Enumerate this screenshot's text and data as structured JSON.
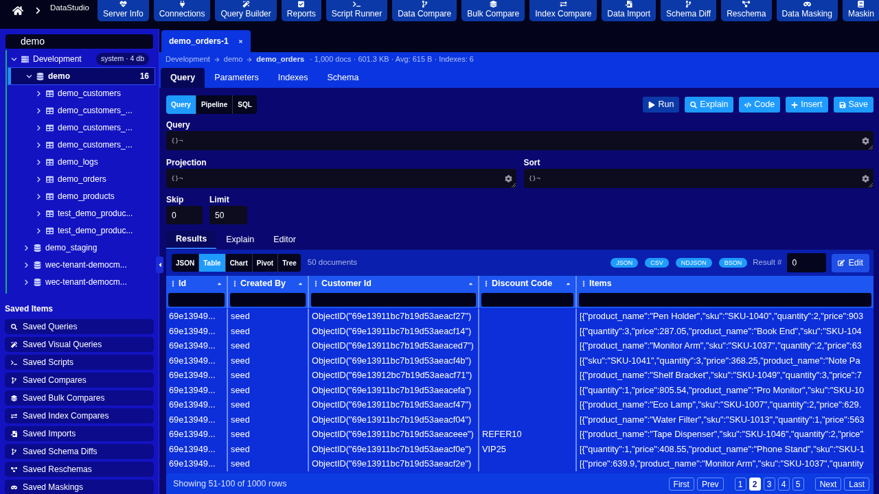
{
  "top_bar": {
    "app_name": "DataStudio",
    "nav": [
      {
        "label": "Server Info"
      },
      {
        "label": "Connections"
      },
      {
        "label": "Query Builder"
      },
      {
        "label": "Reports"
      },
      {
        "label": "Script Runner"
      },
      {
        "label": "Data Compare"
      },
      {
        "label": "Bulk Compare"
      },
      {
        "label": "Index Compare"
      },
      {
        "label": "Data Import"
      },
      {
        "label": "Schema Diff"
      },
      {
        "label": "Reschema"
      },
      {
        "label": "Data Masking"
      },
      {
        "label": "Maskin"
      }
    ]
  },
  "sidebar": {
    "search": {
      "value": "demo"
    },
    "tree": [
      {
        "label": "Development",
        "kind": "connection",
        "badge": "system · 4 db",
        "expanded": true,
        "selected": false,
        "children": [
          {
            "label": "demo",
            "kind": "database",
            "count": "16",
            "expanded": true,
            "selected": true,
            "children": [
              {
                "label": "demo_customers",
                "kind": "collection",
                "expanded": false,
                "selected": false
              },
              {
                "label": "demo_customers_...",
                "kind": "collection",
                "expanded": false,
                "selected": false
              },
              {
                "label": "demo_customers_...",
                "kind": "collection",
                "expanded": false,
                "selected": false
              },
              {
                "label": "demo_customers_...",
                "kind": "collection",
                "expanded": false,
                "selected": false
              },
              {
                "label": "demo_logs",
                "kind": "collection",
                "expanded": false,
                "selected": false
              },
              {
                "label": "demo_orders",
                "kind": "collection",
                "expanded": false,
                "selected": false
              },
              {
                "label": "demo_products",
                "kind": "collection",
                "expanded": false,
                "selected": false
              },
              {
                "label": "test_demo_produc...",
                "kind": "collection",
                "expanded": false,
                "selected": false
              },
              {
                "label": "test_demo_produc...",
                "kind": "collection",
                "expanded": false,
                "selected": false
              }
            ]
          },
          {
            "label": "demo_staging",
            "kind": "database",
            "expanded": false,
            "selected": false
          },
          {
            "label": "wec-tenant-democm...",
            "kind": "database",
            "expanded": false,
            "selected": false
          },
          {
            "label": "wec-tenant-democm...",
            "kind": "database",
            "expanded": false,
            "selected": false
          }
        ]
      }
    ],
    "saved_title": "Saved Items",
    "saved_items": [
      {
        "label": "Saved Queries"
      },
      {
        "label": "Saved Visual Queries"
      },
      {
        "label": "Saved Scripts"
      },
      {
        "label": "Saved Compares"
      },
      {
        "label": "Saved Bulk Compares"
      },
      {
        "label": "Saved Index Compares"
      },
      {
        "label": "Saved Imports"
      },
      {
        "label": "Saved Schema Diffs"
      },
      {
        "label": "Saved Reschemas"
      },
      {
        "label": "Saved Maskings"
      }
    ]
  },
  "editor_tabs": [
    {
      "label": "demo_orders-1",
      "selected": true
    }
  ],
  "breadcrumb": {
    "path": [
      "Development",
      "demo",
      "demo_orders"
    ],
    "stats": "· 1,000 docs · 601.3 KB · Avg: 615 B · Indexes: 6"
  },
  "sub_tabs": [
    {
      "label": "Query",
      "selected": true
    },
    {
      "label": "Parameters",
      "selected": false
    },
    {
      "label": "Indexes",
      "selected": false
    },
    {
      "label": "Schema",
      "selected": false
    }
  ],
  "mode_toggle": [
    {
      "label": "Query",
      "selected": true
    },
    {
      "label": "Pipeline",
      "selected": false
    },
    {
      "label": "SQL",
      "selected": false
    }
  ],
  "actions": [
    {
      "label": "Run",
      "kind": "primary"
    },
    {
      "label": "Explain",
      "kind": "accent"
    },
    {
      "label": "Code",
      "kind": "accent"
    },
    {
      "label": "Insert",
      "kind": "accent"
    },
    {
      "label": "Save",
      "kind": "accent"
    }
  ],
  "query_form": {
    "query": {
      "label": "Query",
      "value": "{}¬"
    },
    "projection": {
      "label": "Projection",
      "value": "{}¬"
    },
    "sort": {
      "label": "Sort",
      "value": "{}¬"
    },
    "skip": {
      "label": "Skip",
      "value": "0"
    },
    "limit": {
      "label": "Limit",
      "value": "50"
    }
  },
  "result_tabs": [
    {
      "label": "Results",
      "selected": true
    },
    {
      "label": "Explain",
      "selected": false
    },
    {
      "label": "Editor",
      "selected": false
    }
  ],
  "results": {
    "view_toggle": [
      {
        "label": "JSON",
        "selected": false
      },
      {
        "label": "Table",
        "selected": true
      },
      {
        "label": "Chart",
        "selected": false
      },
      {
        "label": "Pivot",
        "selected": false
      },
      {
        "label": "Tree",
        "selected": false
      }
    ],
    "count": "50 documents",
    "exports": [
      "JSON",
      "CSV",
      "NDJSON",
      "BSON"
    ],
    "result_label": "Result #",
    "result_value": "0",
    "edit_button": "Edit",
    "table": {
      "columns": [
        {
          "label": "Id",
          "sortable": true
        },
        {
          "label": "Created By",
          "sortable": true
        },
        {
          "label": "Customer Id",
          "sortable": true
        },
        {
          "label": "Discount Code",
          "sortable": true
        },
        {
          "label": "Items",
          "sortable": false
        }
      ],
      "rows": [
        {
          "id": "69e13949...",
          "created_by": "seed",
          "customer_id": "ObjectID(\"69e13911bc7b19d53aeacf27\")",
          "items": "[{\"product_name\":\"Pen Holder\",\"sku\":\"SKU-1040\",\"quantity\":2,\"price\":903"
        },
        {
          "id": "69e13949...",
          "created_by": "seed",
          "customer_id": "ObjectID(\"69e13911bc7b19d53aeacf14\")",
          "items": "[{\"quantity\":3,\"price\":287.05,\"product_name\":\"Book End\",\"sku\":\"SKU-104"
        },
        {
          "id": "69e13949...",
          "created_by": "seed",
          "customer_id": "ObjectID(\"69e13911bc7b19d53aeaced7\")",
          "items": "[{\"product_name\":\"Monitor Arm\",\"sku\":\"SKU-1037\",\"quantity\":2,\"price\":63"
        },
        {
          "id": "69e13949...",
          "created_by": "seed",
          "customer_id": "ObjectID(\"69e13911bc7b19d53aeacf4b\")",
          "items": "[{\"sku\":\"SKU-1041\",\"quantity\":3,\"price\":368.25,\"product_name\":\"Note Pa"
        },
        {
          "id": "69e13949...",
          "created_by": "seed",
          "customer_id": "ObjectID(\"69e13912bc7b19d53aeacf71\")",
          "items": "[{\"product_name\":\"Shelf Bracket\",\"sku\":\"SKU-1049\",\"quantity\":3,\"price\":7"
        },
        {
          "id": "69e13949...",
          "created_by": "seed",
          "customer_id": "ObjectID(\"69e13911bc7b19d53aeacefa\")",
          "items": "[{\"quantity\":1,\"price\":805.54,\"product_name\":\"Pro Monitor\",\"sku\":\"SKU-10"
        },
        {
          "id": "69e13949...",
          "created_by": "seed",
          "customer_id": "ObjectID(\"69e13911bc7b19d53aeacf47\")",
          "items": "[{\"product_name\":\"Eco Lamp\",\"sku\":\"SKU-1007\",\"quantity\":2,\"price\":629."
        },
        {
          "id": "69e13949...",
          "created_by": "seed",
          "customer_id": "ObjectID(\"69e13911bc7b19d53aeacf04\")",
          "items": "[{\"product_name\":\"Water Filter\",\"sku\":\"SKU-1013\",\"quantity\":1,\"price\":563"
        },
        {
          "id": "69e13949...",
          "created_by": "seed",
          "customer_id": "ObjectID(\"69e13911bc7b19d53aeaceee\")",
          "discount_code": "REFER10",
          "items": "[{\"product_name\":\"Tape Dispenser\",\"sku\":\"SKU-1046\",\"quantity\":2,\"price\""
        },
        {
          "id": "69e13949...",
          "created_by": "seed",
          "customer_id": "ObjectID(\"69e13911bc7b19d53aeacf0e\")",
          "discount_code": "VIP25",
          "items": "[{\"quantity\":1,\"price\":408.55,\"product_name\":\"Phone Stand\",\"sku\":\"SKU-1"
        },
        {
          "id": "69e13949...",
          "created_by": "seed",
          "customer_id": "ObjectID(\"69e13911bc7b19d53aeacf2e\")",
          "items": "[{\"price\":639.9,\"product_name\":\"Monitor Arm\",\"sku\":\"SKU-1037\",\"quantity"
        }
      ]
    },
    "footer": {
      "summary": "Showing 51-100 of 1000 rows",
      "first": "First",
      "prev": "Prev",
      "pages": [
        {
          "label": "1",
          "selected": false
        },
        {
          "label": "2",
          "selected": true
        },
        {
          "label": "3",
          "selected": false
        },
        {
          "label": "4",
          "selected": false
        },
        {
          "label": "5",
          "selected": false
        }
      ],
      "next": "Next",
      "last": "Last"
    }
  }
}
